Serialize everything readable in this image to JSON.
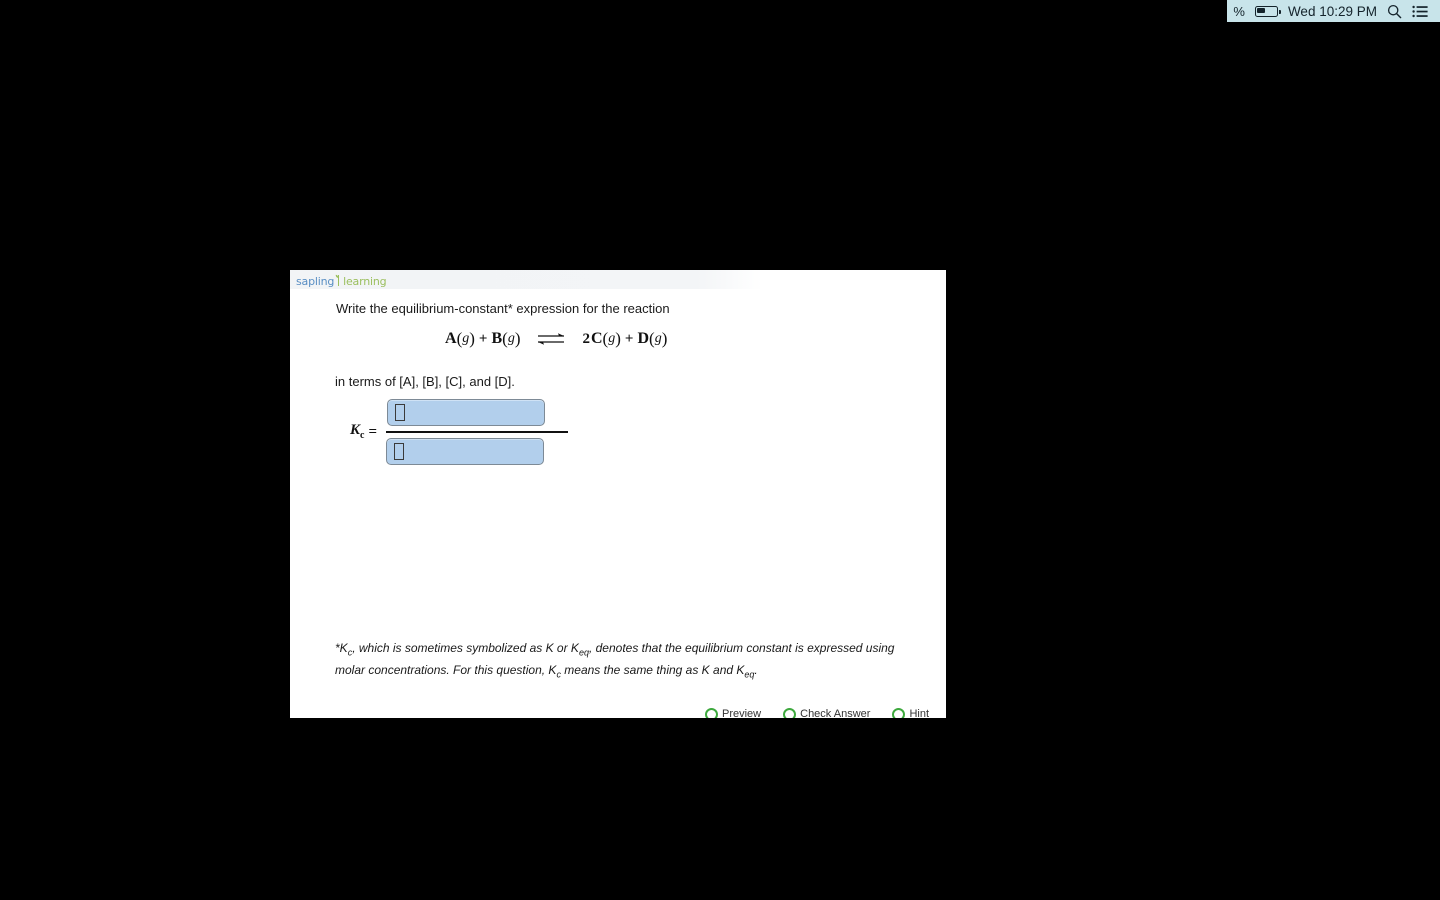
{
  "menubar": {
    "battery_percent_fragment": "%",
    "battery_icon": "battery-icon",
    "clock": "Wed 10:29 PM",
    "search_icon": "search-icon",
    "notification_center_icon": "notification-center-icon"
  },
  "window": {
    "logo": {
      "word1": "sapling",
      "word2": "learning",
      "mark_color": "#9bbf5e",
      "word1_color": "#5a8fc4",
      "word2_color": "#9bbf5e"
    }
  },
  "question": {
    "prompt": "Write the equilibrium-constant* expression for the reaction",
    "in_terms_of": "in terms of [A], [B], [C], and [D].",
    "reaction": {
      "left": [
        {
          "coefficient": "",
          "species": "A",
          "state": "g"
        },
        {
          "coefficient": "",
          "species": "B",
          "state": "g"
        }
      ],
      "arrow": "equilibrium-double-arrow",
      "right": [
        {
          "coefficient": "2",
          "species": "C",
          "state": "g"
        },
        {
          "coefficient": "",
          "species": "D",
          "state": "g"
        }
      ],
      "plain_text": "A(g) + B(g) ⇌ 2C(g) + D(g)"
    },
    "answer": {
      "kc_symbol": "K",
      "kc_subscript": "c",
      "equals": "=",
      "numerator_value": "",
      "numerator_placeholder": "",
      "denominator_value": "",
      "denominator_placeholder": "",
      "box_fill_color": "#b2cfec"
    },
    "footnote_line1_a": "*K",
    "footnote_line1_sub": "c",
    "footnote_line1_b": ", which is sometimes symbolized as K or K",
    "footnote_line1_sub2": "eq",
    "footnote_line1_c": ", denotes that the equilibrium constant is",
    "footnote_line2_a": "expressed using molar concentrations. For this question, K",
    "footnote_line2_sub": "c",
    "footnote_line2_b": " means the same thing as K and K",
    "footnote_line2_sub2": "eq",
    "footnote_line2_c": "."
  },
  "toolbar": {
    "preview_label": "Preview",
    "check_answer_label": "Check Answer",
    "hint_label": "Hint",
    "report_icon": "report-flag-icon"
  }
}
